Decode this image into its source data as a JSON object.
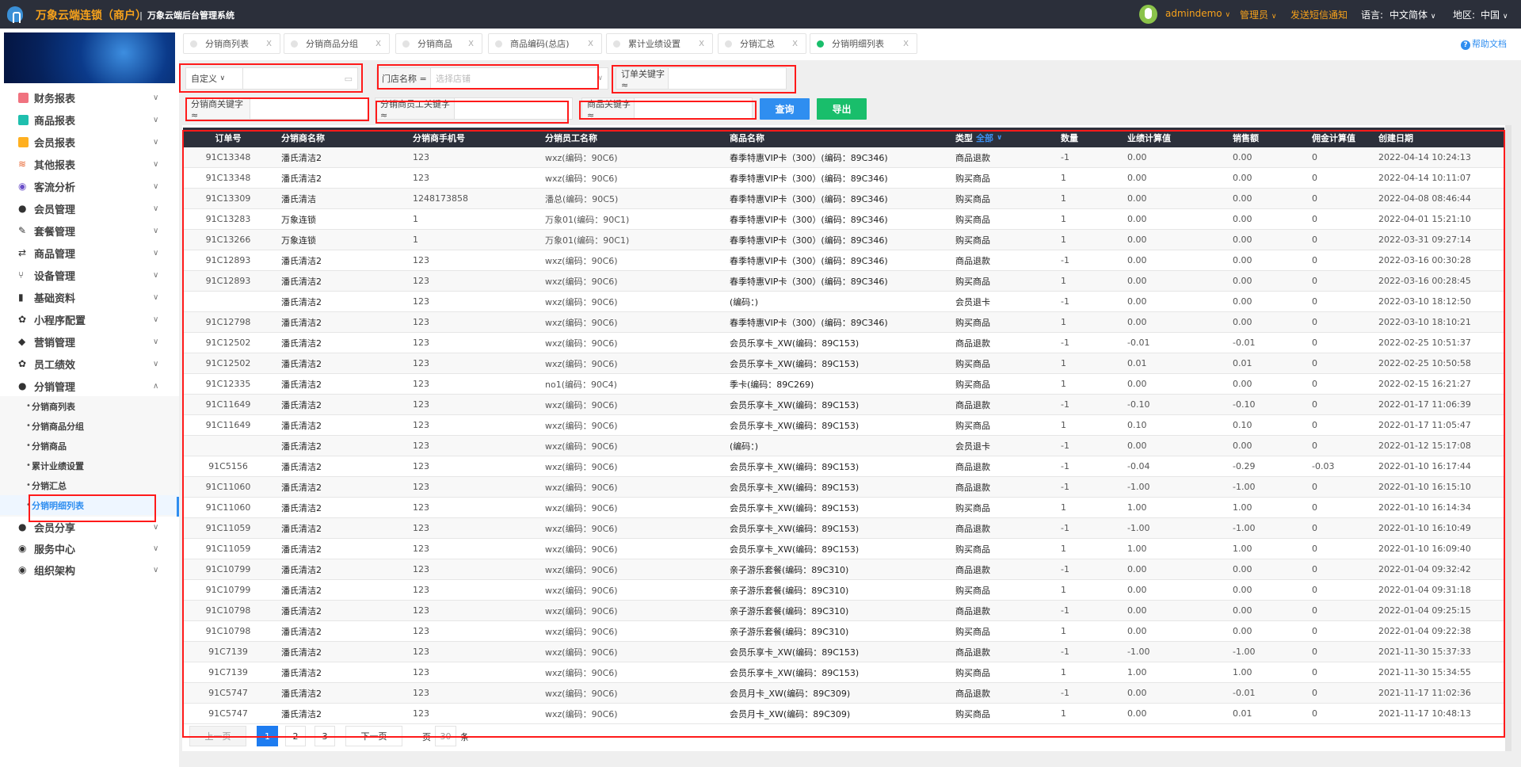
{
  "header": {
    "brand": "万象云端连锁（商户）",
    "system": "万象云端后台管理系统",
    "user": "admindemo",
    "role": "管理员",
    "sms": "发送短信通知",
    "lang_label": "语言:",
    "lang": "中文简体",
    "region_label": "地区:",
    "region": "中国",
    "colors": {
      "bar": "#2b2f3a",
      "accent": "#f7a21b"
    }
  },
  "sidebar": {
    "items": [
      {
        "label": "财务报表",
        "icon": "book-icon",
        "color": "#f0727f"
      },
      {
        "label": "商品报表",
        "icon": "book-icon",
        "color": "#1fbfae"
      },
      {
        "label": "会员报表",
        "icon": "book-icon",
        "color": "#ffb020"
      },
      {
        "label": "其他报表",
        "icon": "layers-icon",
        "color": "#e8622c"
      },
      {
        "label": "客流分析",
        "icon": "target-icon",
        "color": "#6a4fc9"
      },
      {
        "label": "会员管理",
        "icon": "user-icon",
        "color": "#333"
      },
      {
        "label": "套餐管理",
        "icon": "edit-icon",
        "color": "#333"
      },
      {
        "label": "商品管理",
        "icon": "swap-icon",
        "color": "#333"
      },
      {
        "label": "设备管理",
        "icon": "branch-icon",
        "color": "#333"
      },
      {
        "label": "基础资料",
        "icon": "file-icon",
        "color": "#333"
      },
      {
        "label": "小程序配置",
        "icon": "gear-icon",
        "color": "#333"
      },
      {
        "label": "营销管理",
        "icon": "tag-icon",
        "color": "#333"
      },
      {
        "label": "员工绩效",
        "icon": "gear-icon",
        "color": "#333"
      },
      {
        "label": "分销管理",
        "icon": "users-icon",
        "color": "#333",
        "expanded": true
      }
    ],
    "sub_items": [
      "分销商列表",
      "分销商品分组",
      "分销商品",
      "累计业绩设置",
      "分销汇总",
      "分销明细列表"
    ],
    "active_sub": "分销明细列表",
    "after_items": [
      {
        "label": "会员分享",
        "icon": "users-icon"
      },
      {
        "label": "服务中心",
        "icon": "radio-icon"
      },
      {
        "label": "组织架构",
        "icon": "radio-icon"
      }
    ]
  },
  "tabs": [
    {
      "label": "分销商列表",
      "active": false
    },
    {
      "label": "分销商品分组",
      "active": false
    },
    {
      "label": "分销商品",
      "active": false
    },
    {
      "label": "商品编码(总店)",
      "active": false
    },
    {
      "label": "累计业绩设置",
      "active": false
    },
    {
      "label": "分销汇总",
      "active": false
    },
    {
      "label": "分销明细列表",
      "active": true
    }
  ],
  "tab_close": "X",
  "help": "帮助文档",
  "filters": {
    "date_mode": "自定义",
    "date_value": "",
    "store_label": "门店名称 =",
    "store_placeholder": "选择店铺",
    "order_label": "订单关键字 ≈",
    "order_value": "",
    "distributor_label": "分销商关键字 ≈",
    "distributor_value": "",
    "staff_label": "分销商员工关键字 ≈",
    "staff_value": "",
    "product_label": "商品关键字 ≈",
    "product_value": "",
    "query": "查询",
    "export": "导出"
  },
  "table": {
    "columns": [
      "订单号",
      "分销商名称",
      "分销商手机号",
      "分销员工名称",
      "商品名称",
      "类型",
      "数量",
      "业绩计算值",
      "销售额",
      "佣金计算值",
      "创建日期"
    ],
    "type_filter": "全部",
    "rows": [
      [
        "91C13348",
        "潘氏清洁2",
        "123",
        "wxz(编码：90C6)",
        "春季特惠VIP卡（300）(编码：89C346)",
        "商品退款",
        "-1",
        "0.00",
        "0.00",
        "0",
        "2022-04-14 10:24:13"
      ],
      [
        "91C13348",
        "潘氏清洁2",
        "123",
        "wxz(编码：90C6)",
        "春季特惠VIP卡（300）(编码：89C346)",
        "购买商品",
        "1",
        "0.00",
        "0.00",
        "0",
        "2022-04-14 10:11:07"
      ],
      [
        "91C13309",
        "潘氏清洁",
        "1248173858",
        "潘总(编码：90C5)",
        "春季特惠VIP卡（300）(编码：89C346)",
        "购买商品",
        "1",
        "0.00",
        "0.00",
        "0",
        "2022-04-08 08:46:44"
      ],
      [
        "91C13283",
        "万象连锁",
        "1",
        "万象01(编码：90C1)",
        "春季特惠VIP卡（300）(编码：89C346)",
        "购买商品",
        "1",
        "0.00",
        "0.00",
        "0",
        "2022-04-01 15:21:10"
      ],
      [
        "91C13266",
        "万象连锁",
        "1",
        "万象01(编码：90C1)",
        "春季特惠VIP卡（300）(编码：89C346)",
        "购买商品",
        "1",
        "0.00",
        "0.00",
        "0",
        "2022-03-31 09:27:14"
      ],
      [
        "91C12893",
        "潘氏清洁2",
        "123",
        "wxz(编码：90C6)",
        "春季特惠VIP卡（300）(编码：89C346)",
        "商品退款",
        "-1",
        "0.00",
        "0.00",
        "0",
        "2022-03-16 00:30:28"
      ],
      [
        "91C12893",
        "潘氏清洁2",
        "123",
        "wxz(编码：90C6)",
        "春季特惠VIP卡（300）(编码：89C346)",
        "购买商品",
        "1",
        "0.00",
        "0.00",
        "0",
        "2022-03-16 00:28:45"
      ],
      [
        "",
        "潘氏清洁2",
        "123",
        "wxz(编码：90C6)",
        "(编码：)",
        "会员退卡",
        "-1",
        "0.00",
        "0.00",
        "0",
        "2022-03-10 18:12:50"
      ],
      [
        "91C12798",
        "潘氏清洁2",
        "123",
        "wxz(编码：90C6)",
        "春季特惠VIP卡（300）(编码：89C346)",
        "购买商品",
        "1",
        "0.00",
        "0.00",
        "0",
        "2022-03-10 18:10:21"
      ],
      [
        "91C12502",
        "潘氏清洁2",
        "123",
        "wxz(编码：90C6)",
        "会员乐享卡_XW(编码：89C153)",
        "商品退款",
        "-1",
        "-0.01",
        "-0.01",
        "0",
        "2022-02-25 10:51:37"
      ],
      [
        "91C12502",
        "潘氏清洁2",
        "123",
        "wxz(编码：90C6)",
        "会员乐享卡_XW(编码：89C153)",
        "购买商品",
        "1",
        "0.01",
        "0.01",
        "0",
        "2022-02-25 10:50:58"
      ],
      [
        "91C12335",
        "潘氏清洁2",
        "123",
        "no1(编码：90C4)",
        "季卡(编码：89C269)",
        "购买商品",
        "1",
        "0.00",
        "0.00",
        "0",
        "2022-02-15 16:21:27"
      ],
      [
        "91C11649",
        "潘氏清洁2",
        "123",
        "wxz(编码：90C6)",
        "会员乐享卡_XW(编码：89C153)",
        "商品退款",
        "-1",
        "-0.10",
        "-0.10",
        "0",
        "2022-01-17 11:06:39"
      ],
      [
        "91C11649",
        "潘氏清洁2",
        "123",
        "wxz(编码：90C6)",
        "会员乐享卡_XW(编码：89C153)",
        "购买商品",
        "1",
        "0.10",
        "0.10",
        "0",
        "2022-01-17 11:05:47"
      ],
      [
        "",
        "潘氏清洁2",
        "123",
        "wxz(编码：90C6)",
        "(编码：)",
        "会员退卡",
        "-1",
        "0.00",
        "0.00",
        "0",
        "2022-01-12 15:17:08"
      ],
      [
        "91C5156",
        "潘氏清洁2",
        "123",
        "wxz(编码：90C6)",
        "会员乐享卡_XW(编码：89C153)",
        "商品退款",
        "-1",
        "-0.04",
        "-0.29",
        "-0.03",
        "2022-01-10 16:17:44"
      ],
      [
        "91C11060",
        "潘氏清洁2",
        "123",
        "wxz(编码：90C6)",
        "会员乐享卡_XW(编码：89C153)",
        "商品退款",
        "-1",
        "-1.00",
        "-1.00",
        "0",
        "2022-01-10 16:15:10"
      ],
      [
        "91C11060",
        "潘氏清洁2",
        "123",
        "wxz(编码：90C6)",
        "会员乐享卡_XW(编码：89C153)",
        "购买商品",
        "1",
        "1.00",
        "1.00",
        "0",
        "2022-01-10 16:14:34"
      ],
      [
        "91C11059",
        "潘氏清洁2",
        "123",
        "wxz(编码：90C6)",
        "会员乐享卡_XW(编码：89C153)",
        "商品退款",
        "-1",
        "-1.00",
        "-1.00",
        "0",
        "2022-01-10 16:10:49"
      ],
      [
        "91C11059",
        "潘氏清洁2",
        "123",
        "wxz(编码：90C6)",
        "会员乐享卡_XW(编码：89C153)",
        "购买商品",
        "1",
        "1.00",
        "1.00",
        "0",
        "2022-01-10 16:09:40"
      ],
      [
        "91C10799",
        "潘氏清洁2",
        "123",
        "wxz(编码：90C6)",
        "亲子游乐套餐(编码：89C310)",
        "商品退款",
        "-1",
        "0.00",
        "0.00",
        "0",
        "2022-01-04 09:32:42"
      ],
      [
        "91C10799",
        "潘氏清洁2",
        "123",
        "wxz(编码：90C6)",
        "亲子游乐套餐(编码：89C310)",
        "购买商品",
        "1",
        "0.00",
        "0.00",
        "0",
        "2022-01-04 09:31:18"
      ],
      [
        "91C10798",
        "潘氏清洁2",
        "123",
        "wxz(编码：90C6)",
        "亲子游乐套餐(编码：89C310)",
        "商品退款",
        "-1",
        "0.00",
        "0.00",
        "0",
        "2022-01-04 09:25:15"
      ],
      [
        "91C10798",
        "潘氏清洁2",
        "123",
        "wxz(编码：90C6)",
        "亲子游乐套餐(编码：89C310)",
        "购买商品",
        "1",
        "0.00",
        "0.00",
        "0",
        "2022-01-04 09:22:38"
      ],
      [
        "91C7139",
        "潘氏清洁2",
        "123",
        "wxz(编码：90C6)",
        "会员乐享卡_XW(编码：89C153)",
        "商品退款",
        "-1",
        "-1.00",
        "-1.00",
        "0",
        "2021-11-30 15:37:33"
      ],
      [
        "91C7139",
        "潘氏清洁2",
        "123",
        "wxz(编码：90C6)",
        "会员乐享卡_XW(编码：89C153)",
        "购买商品",
        "1",
        "1.00",
        "1.00",
        "0",
        "2021-11-30 15:34:55"
      ],
      [
        "91C5747",
        "潘氏清洁2",
        "123",
        "wxz(编码：90C6)",
        "会员月卡_XW(编码：89C309)",
        "商品退款",
        "-1",
        "0.00",
        "-0.01",
        "0",
        "2021-11-17 11:02:36"
      ],
      [
        "91C5747",
        "潘氏清洁2",
        "123",
        "wxz(编码：90C6)",
        "会员月卡_XW(编码：89C309)",
        "购买商品",
        "1",
        "0.00",
        "0.01",
        "0",
        "2021-11-17 10:48:13"
      ]
    ]
  },
  "pagination": {
    "prev": "上一页",
    "pages": [
      "1",
      "2",
      "3"
    ],
    "current": "1",
    "next": "下一页",
    "per_page_label": "一页",
    "per_page": "30",
    "unit": "条"
  }
}
